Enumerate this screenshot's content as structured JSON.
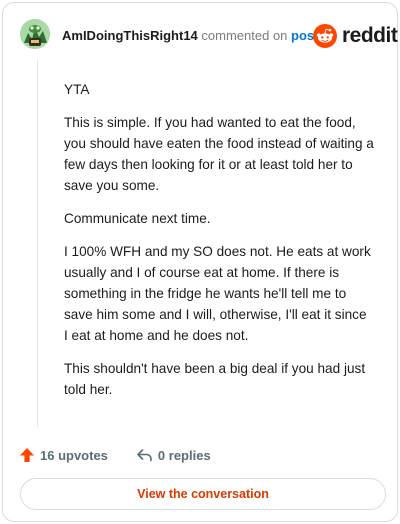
{
  "header": {
    "username": "AmIDoingThisRight14",
    "action_text": "commented on",
    "post_link": "post",
    "brand": "reddit"
  },
  "comment": {
    "paragraphs": [
      "YTA",
      "This is simple. If you had wanted to eat the food, you should have eaten the food instead of waiting a few days then looking for it or at least told her to save you some.",
      "Communicate next time.",
      "I 100% WFH and my SO does not. He eats at work usually and I of course eat at home. If there is something in the fridge he wants he'll tell me to save him some and I will, otherwise, I'll eat it since I eat at home and he does not.",
      "This shouldn't have been a big deal if you had just told her."
    ]
  },
  "actions": {
    "upvotes": "16 upvotes",
    "replies": "0 replies"
  },
  "view_button": "View the conversation",
  "colors": {
    "upvote": "#ff4500",
    "link": "#0079d3",
    "cta": "#d93a00",
    "brand": "#ff4500"
  }
}
